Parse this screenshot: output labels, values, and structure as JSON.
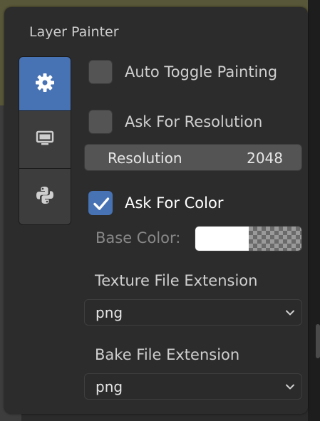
{
  "panel": {
    "title": "Layer Painter"
  },
  "tabs": [
    {
      "name": "settings",
      "icon": "gear-icon",
      "active": true
    },
    {
      "name": "display",
      "icon": "monitor-icon",
      "active": false
    },
    {
      "name": "scripting",
      "icon": "python-icon",
      "active": false
    }
  ],
  "settings": {
    "auto_toggle_painting": {
      "label": "Auto Toggle Painting",
      "checked": false
    },
    "ask_for_resolution": {
      "label": "Ask For Resolution",
      "checked": false
    },
    "resolution": {
      "label": "Resolution",
      "value": "2048"
    },
    "ask_for_color": {
      "label": "Ask For Color",
      "checked": true
    },
    "base_color": {
      "label": "Base Color:",
      "color": "#ffffff"
    },
    "texture_file_extension": {
      "label": "Texture File Extension",
      "value": "png"
    },
    "bake_file_extension": {
      "label": "Bake File Extension",
      "value": "png"
    }
  },
  "colors": {
    "accent": "#4772b3",
    "panel": "#2c2c2c",
    "field": "#545454"
  }
}
